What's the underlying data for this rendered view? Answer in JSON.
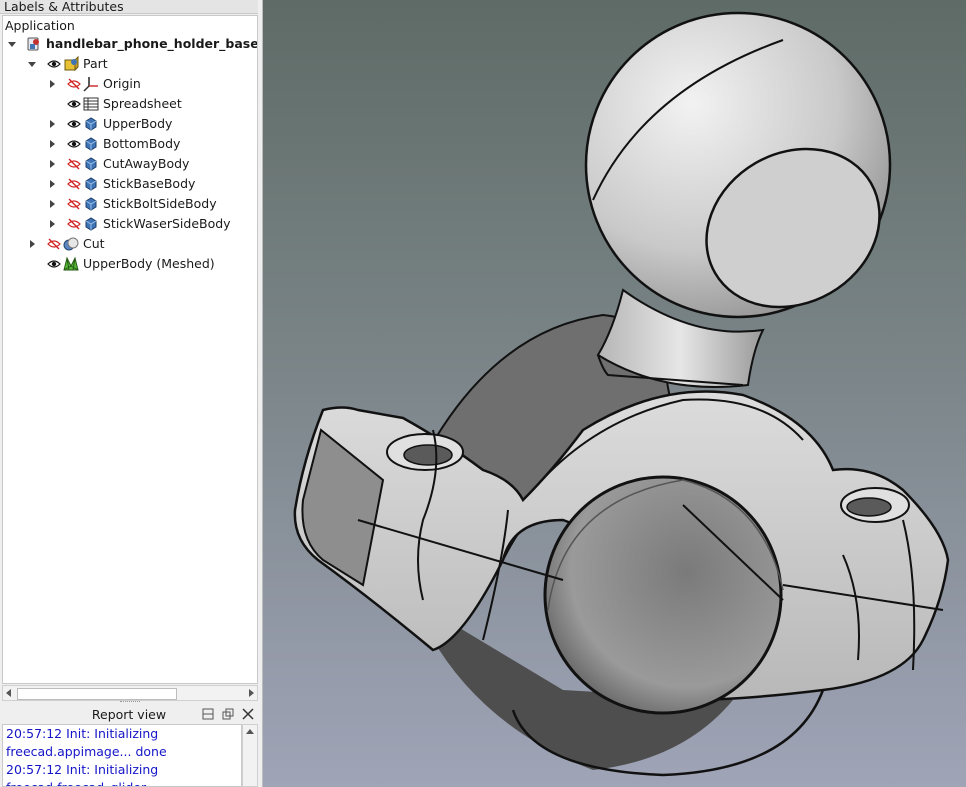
{
  "tree_panel": {
    "header": "Labels & Attributes",
    "root_label": "Application",
    "items": [
      {
        "label": "handlebar_phone_holder_base_",
        "icon": "document-icon",
        "expanded": true
      },
      {
        "label": "Part",
        "icon": "part-icon",
        "expanded": true,
        "visible": true
      },
      {
        "label": "Origin",
        "icon": "origin-icon",
        "visible": false
      },
      {
        "label": "Spreadsheet",
        "icon": "spreadsheet-icon",
        "visible": true
      },
      {
        "label": "UpperBody",
        "icon": "body-icon",
        "visible": true
      },
      {
        "label": "BottomBody",
        "icon": "body-icon",
        "visible": true
      },
      {
        "label": "CutAwayBody",
        "icon": "body-icon",
        "visible": false
      },
      {
        "label": "StickBaseBody",
        "icon": "body-icon",
        "visible": false
      },
      {
        "label": "StickBoltSideBody",
        "icon": "body-icon",
        "visible": false
      },
      {
        "label": "StickWaserSideBody",
        "icon": "body-icon",
        "visible": false
      },
      {
        "label": "Cut",
        "icon": "cut-icon",
        "visible": false
      },
      {
        "label": "UpperBody (Meshed)",
        "icon": "mesh-icon",
        "visible": true
      }
    ]
  },
  "report_view": {
    "title": "Report view",
    "lines": [
      "20:57:12  Init: Initializing",
      "freecad.appimage... done",
      "20:57:12  Init: Initializing",
      "freecad.freecad_glider..."
    ]
  },
  "colors": {
    "report_text": "#1515c9",
    "body_icon": "#3f74b5",
    "hidden_eye": "#d02020",
    "viewport_top": "#5e6b66",
    "viewport_bottom": "#9fa4b7"
  }
}
